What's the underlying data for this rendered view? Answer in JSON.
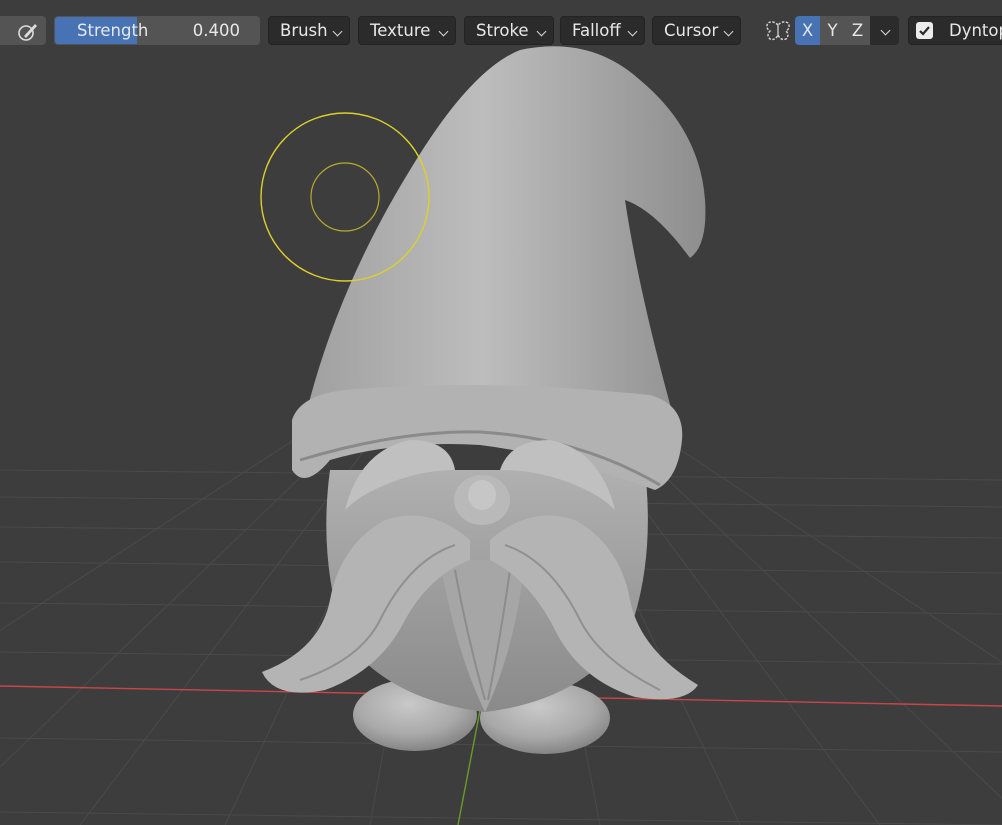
{
  "toolbar": {
    "strength": {
      "label": "Strength",
      "value": "0.400",
      "fill_fraction": 0.4
    },
    "dropdowns": [
      {
        "label": "Brush"
      },
      {
        "label": "Texture"
      },
      {
        "label": "Stroke"
      },
      {
        "label": "Falloff"
      },
      {
        "label": "Cursor"
      }
    ],
    "symmetry": {
      "axes": [
        {
          "label": "X",
          "active": true
        },
        {
          "label": "Y",
          "active": false
        },
        {
          "label": "Z",
          "active": false
        }
      ]
    },
    "dyntopo": {
      "label": "Dyntopo",
      "checked": true
    }
  },
  "colors": {
    "viewport_bg": "#3d3d3d",
    "grid_line": "#4a4a4a",
    "x_axis": "#c8464b",
    "y_axis": "#6a9a2a",
    "brush_cursor": "#ddd02a",
    "accent": "#4772b3",
    "model_clay": "#b4b4b4"
  },
  "icons": {
    "brush_tool": "pen-icon",
    "symmetry": "butterfly-icon",
    "dyntopo_check": "checkbox-icon"
  }
}
